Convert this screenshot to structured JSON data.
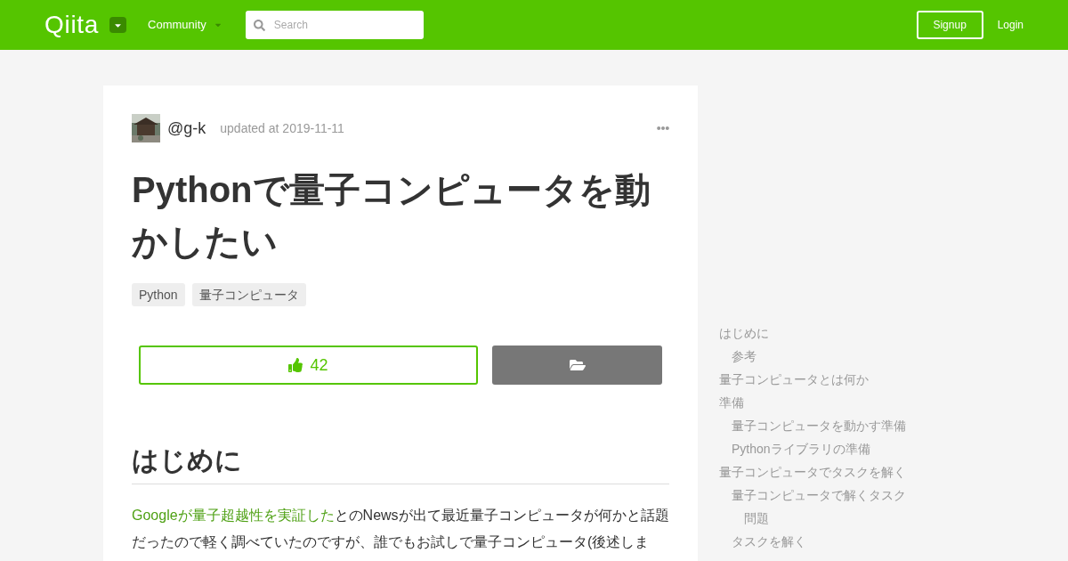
{
  "header": {
    "logo": "Qiita",
    "community": "Community",
    "search": {
      "placeholder": "Search"
    },
    "signup": "Signup",
    "login": "Login"
  },
  "article": {
    "author": "@g-k",
    "updated": "updated at 2019-11-11",
    "title": "Pythonで量子コンピュータを動かしたい",
    "tags": [
      "Python",
      "量子コンピュータ"
    ],
    "likes": "42",
    "heading": "はじめに",
    "paragraph": {
      "link": "Googleが量子超越性を実証した",
      "text": "とのNewsが出て最近量子コンピュータが何かと話題だったので軽く調べていたのですが、誰でもお試しで量子コンピュータ(後述しま"
    }
  },
  "toc": [
    {
      "label": "はじめに",
      "children": [
        {
          "label": "参考"
        }
      ]
    },
    {
      "label": "量子コンピュータとは何か"
    },
    {
      "label": "準備",
      "children": [
        {
          "label": "量子コンピュータを動かす準備"
        },
        {
          "label": "Pythonライブラリの準備"
        }
      ]
    },
    {
      "label": "量子コンピュータでタスクを解く",
      "children": [
        {
          "label": "量子コンピュータで解くタスク",
          "children": [
            {
              "label": "問題"
            }
          ]
        },
        {
          "label": "タスクを解く"
        }
      ]
    }
  ]
}
